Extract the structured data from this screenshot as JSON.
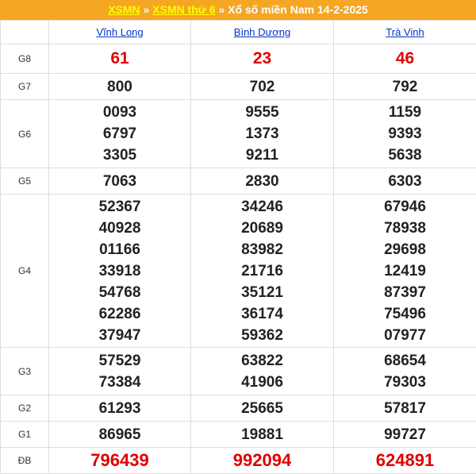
{
  "header": {
    "link1": "XSMN",
    "sep1": " » ",
    "link2": "XSMN thứ 6",
    "sep2": " » ",
    "title": "Xổ số miền Nam 14-2-2025"
  },
  "provinces": [
    "Vĩnh Long",
    "Bình Dương",
    "Trà Vinh"
  ],
  "rows": [
    {
      "label": "G8",
      "values": [
        [
          "61"
        ],
        [
          "23"
        ],
        [
          "46"
        ]
      ]
    },
    {
      "label": "G7",
      "values": [
        [
          "800"
        ],
        [
          "702"
        ],
        [
          "792"
        ]
      ]
    },
    {
      "label": "G6",
      "values": [
        [
          "0093",
          "6797",
          "3305"
        ],
        [
          "9555",
          "1373",
          "9211"
        ],
        [
          "1159",
          "9393",
          "5638"
        ]
      ]
    },
    {
      "label": "G5",
      "values": [
        [
          "7063"
        ],
        [
          "2830"
        ],
        [
          "6303"
        ]
      ]
    },
    {
      "label": "G4",
      "values": [
        [
          "52367",
          "40928",
          "01166",
          "33918",
          "54768",
          "62286",
          "37947"
        ],
        [
          "34246",
          "20689",
          "83982",
          "21716",
          "35121",
          "36174",
          "59362"
        ],
        [
          "67946",
          "78938",
          "29698",
          "12419",
          "87397",
          "75496",
          "07977"
        ]
      ]
    },
    {
      "label": "G3",
      "values": [
        [
          "57529",
          "73384"
        ],
        [
          "63822",
          "41906"
        ],
        [
          "68654",
          "79303"
        ]
      ]
    },
    {
      "label": "G2",
      "values": [
        [
          "61293"
        ],
        [
          "25665"
        ],
        [
          "57817"
        ]
      ]
    },
    {
      "label": "G1",
      "values": [
        [
          "86965"
        ],
        [
          "19881"
        ],
        [
          "99727"
        ]
      ]
    },
    {
      "label": "ĐB",
      "values": [
        [
          "796439"
        ],
        [
          "992094"
        ],
        [
          "624891"
        ]
      ]
    }
  ],
  "colors": {
    "header_bg": "#f5a623",
    "header_link": "#ffff00",
    "prize_red": "#e00000",
    "province_link": "#0033cc"
  }
}
